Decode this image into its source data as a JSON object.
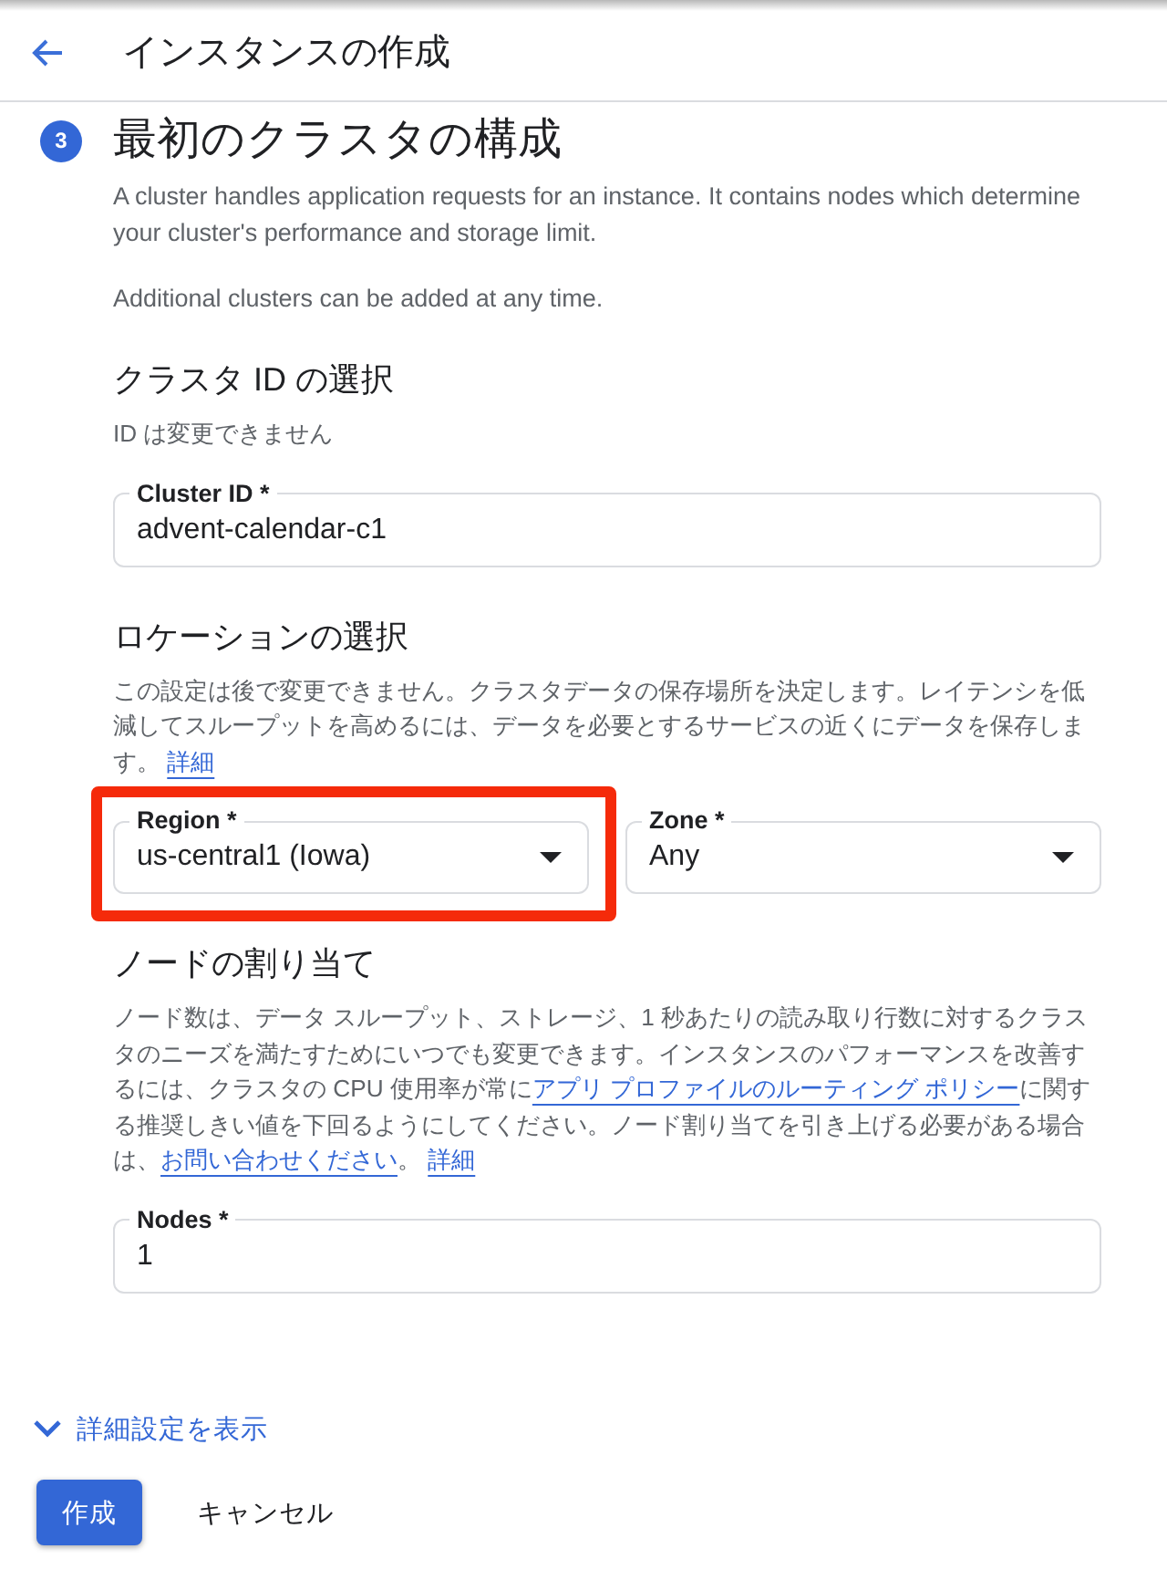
{
  "header": {
    "title": "インスタンスの作成"
  },
  "step": {
    "number": "3",
    "title": "最初のクラスタの構成",
    "paragraphs": [
      "A cluster handles application requests for an instance. It contains nodes which determine your cluster's performance and storage limit.",
      "Additional clusters can be added at any time."
    ]
  },
  "sections": [
    {
      "title": "クラスタ ID の選択",
      "description": [
        {
          "kind": "text",
          "text": "ID は変更できません"
        }
      ],
      "fields": [
        {
          "kind": "text",
          "label": "Cluster ID *",
          "value": "advent-calendar-c1",
          "highlighted": false
        }
      ]
    },
    {
      "title": "ロケーションの選択",
      "description": [
        {
          "kind": "text",
          "text": "この設定は後で変更できません。クラスタデータの保存場所を決定します。レイテンシを低減してスループットを高めるには、データを必要とするサービスの近くにデータを保存します。 "
        },
        {
          "kind": "link",
          "text": "詳細"
        }
      ],
      "fields": [
        {
          "kind": "select",
          "label": "Region *",
          "value": "us-central1 (Iowa)",
          "highlighted": true
        },
        {
          "kind": "select",
          "label": "Zone *",
          "value": "Any",
          "highlighted": false
        }
      ]
    },
    {
      "title": "ノードの割り当て",
      "description": [
        {
          "kind": "text",
          "text": "ノード数は、データ スループット、ストレージ、1 秒あたりの読み取り行数に対するクラスタのニーズを満たすためにいつでも変更できます。インスタンスのパフォーマンスを改善するには、クラスタの CPU 使用率が常に"
        },
        {
          "kind": "link",
          "text": "アプリ プロファイルのルーティング ポリシー"
        },
        {
          "kind": "text",
          "text": "に関する推奨しきい値を下回るようにしてください。ノード割り当てを引き上げる必要がある場合は、"
        },
        {
          "kind": "link",
          "text": "お問い合わせください"
        },
        {
          "kind": "text",
          "text": "。 "
        },
        {
          "kind": "link",
          "text": "詳細"
        }
      ],
      "fields": [
        {
          "kind": "text",
          "label": "Nodes *",
          "value": "1",
          "highlighted": false
        }
      ]
    }
  ],
  "advanced": {
    "label": "詳細設定を表示",
    "expanded": false
  },
  "buttons": [
    {
      "kind": "primary",
      "label": "作成"
    },
    {
      "kind": "text",
      "label": "キャンセル"
    }
  ]
}
